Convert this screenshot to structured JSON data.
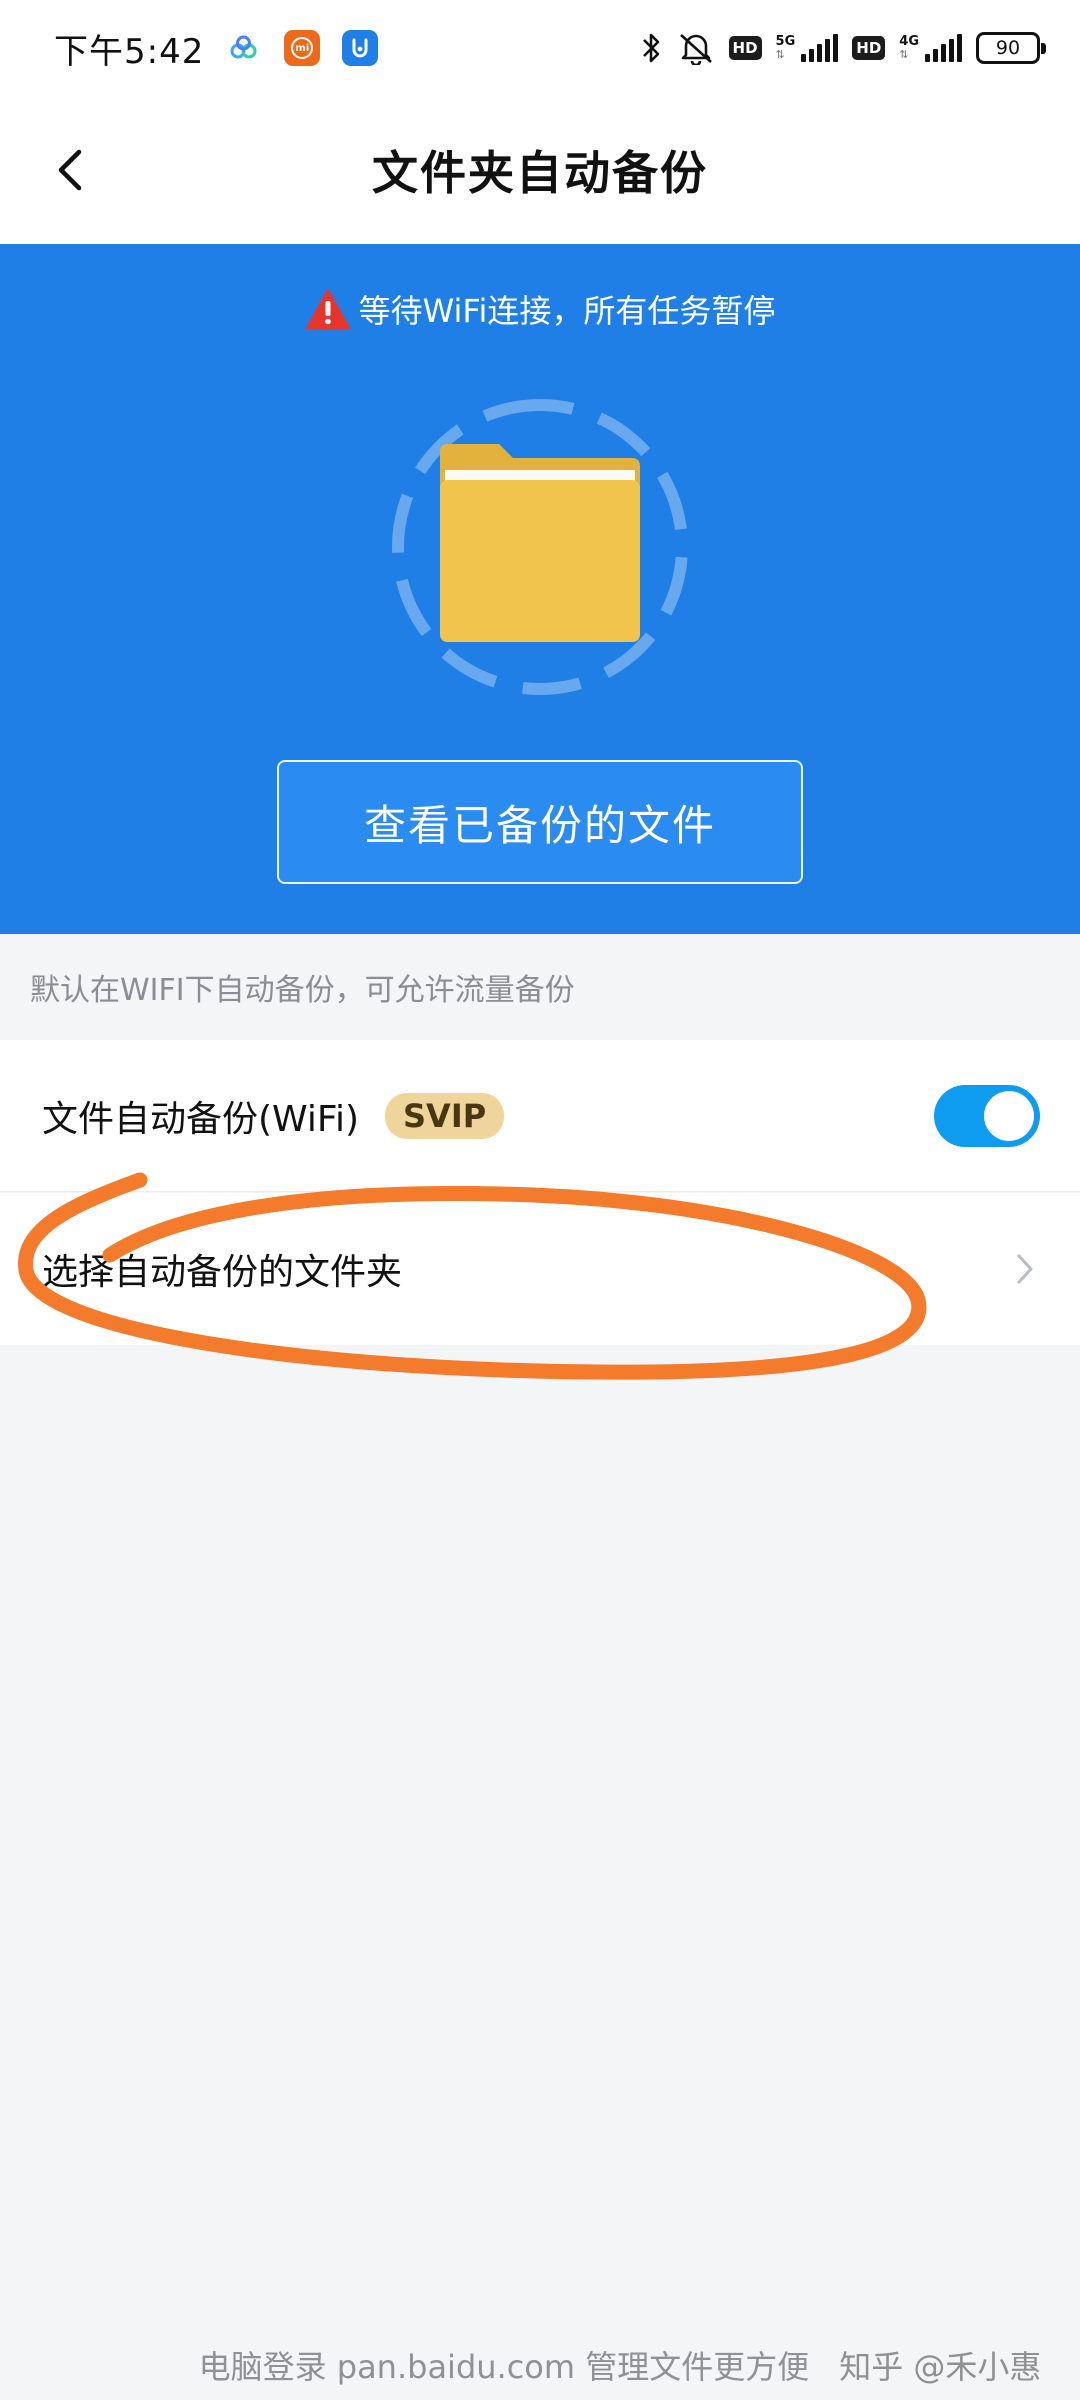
{
  "status_bar": {
    "time": "下午5:42",
    "network_1": "5G",
    "network_2": "4G",
    "hd_label": "HD",
    "battery": "90"
  },
  "header": {
    "title": "文件夹自动备份"
  },
  "hero": {
    "warning": "等待WiFi连接，所有任务暂停",
    "view_button": "查看已备份的文件"
  },
  "info": {
    "text": "默认在WIFI下自动备份，可允许流量备份"
  },
  "settings": {
    "wifi_label": "文件自动备份(WiFi)",
    "svip_badge": "SVIP",
    "wifi_enabled": true,
    "folder_label": "选择自动备份的文件夹"
  },
  "footer": {
    "text": "电脑登录 pan.baidu.com 管理文件更方便",
    "watermark": "知乎 @禾小惠"
  },
  "colors": {
    "brand_blue": "#1f7fe6",
    "toggle_on": "#0d9cf0",
    "folder_yellow": "#f1c44c",
    "svip_gold": "#efd59b",
    "annotation_orange": "#f47a2c",
    "warning_red": "#e8352c"
  },
  "icons": {
    "back": "chevron-left-icon",
    "warning": "warning-triangle-icon",
    "folder": "folder-icon",
    "chevron": "chevron-right-icon",
    "bluetooth": "bluetooth-icon",
    "mute": "bell-off-icon"
  }
}
